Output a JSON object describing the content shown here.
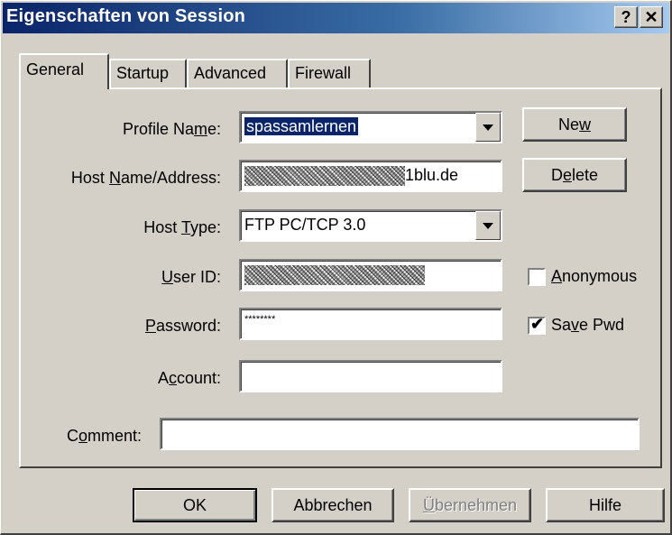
{
  "window": {
    "title": "Eigenschaften von Session"
  },
  "titlebar": {
    "help_symbol": "?",
    "close_symbol": "✕"
  },
  "tabs": [
    {
      "label": "General",
      "active": true
    },
    {
      "label": "Startup",
      "active": false
    },
    {
      "label": "Advanced",
      "active": false
    },
    {
      "label": "Firewall",
      "active": false
    }
  ],
  "form": {
    "profile_name": {
      "label_pre": "Profile Na",
      "label_u": "m",
      "label_post": "e:",
      "value": "spassamlernen"
    },
    "host_name": {
      "label_pre": "Host ",
      "label_u": "N",
      "label_post": "ame/Address:",
      "value_suffix": "1blu.de"
    },
    "host_type": {
      "label_pre": "Host ",
      "label_u": "T",
      "label_post": "ype:",
      "value": "FTP PC/TCP 3.0"
    },
    "user_id": {
      "label_u": "U",
      "label_post": "ser ID:",
      "value": ""
    },
    "password": {
      "label_u": "P",
      "label_post": "assword:",
      "value": "********"
    },
    "account": {
      "label_pre": "A",
      "label_u": "c",
      "label_post": "count:",
      "value": ""
    },
    "comment": {
      "label_pre": "C",
      "label_u": "o",
      "label_post": "mment:",
      "value": ""
    }
  },
  "side_buttons": {
    "new": {
      "pre": "Ne",
      "u": "w",
      "post": ""
    },
    "delete": {
      "pre": "D",
      "u": "e",
      "post": "lete"
    }
  },
  "checkboxes": {
    "anonymous": {
      "u": "A",
      "post": "nonymous",
      "checked": false
    },
    "save_pwd": {
      "pre": "Sa",
      "u": "v",
      "post": "e Pwd",
      "checked": true
    }
  },
  "footer": {
    "ok": "OK",
    "cancel": "Abbrechen",
    "apply_u": "Ü",
    "apply_post": "bernehmen",
    "help": "Hilfe"
  },
  "colors": {
    "titlebar_start": "#0a246a",
    "titlebar_end": "#a6caf0",
    "face": "#d4d0c8"
  }
}
